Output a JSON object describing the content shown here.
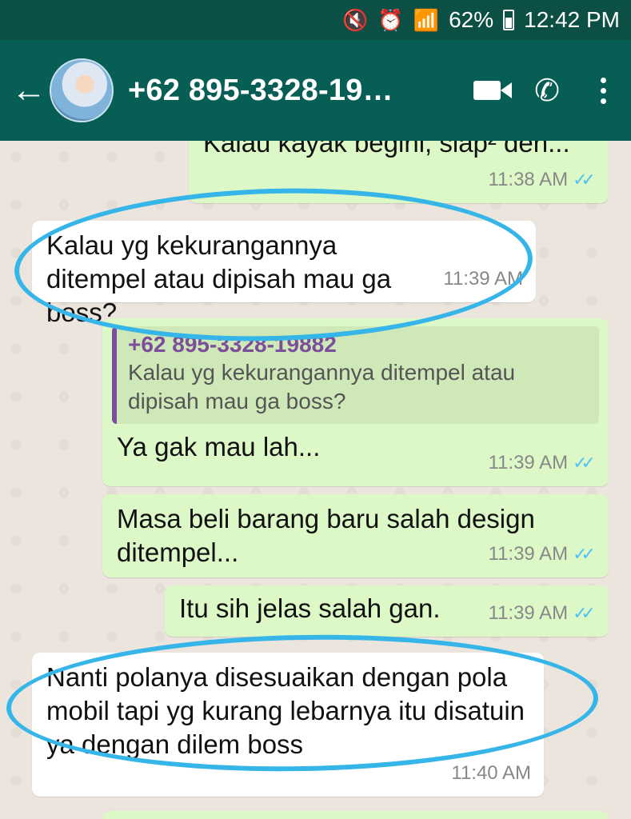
{
  "status_bar": {
    "battery": "62%",
    "time": "12:42 PM"
  },
  "app_bar": {
    "contact_name": "+62 895-3328-19…"
  },
  "messages": [
    {
      "direction": "out",
      "text": "Kalau kayak begini, siap² den...",
      "time": "11:38 AM",
      "ticks": "✓✓"
    },
    {
      "direction": "in",
      "text": "Kalau yg kekurangannya ditempel atau dipisah mau ga boss?",
      "time": "11:39 AM"
    },
    {
      "direction": "out",
      "quote_name": "+62 895-3328-19882",
      "quote_text": "Kalau yg kekurangannya ditempel atau dipisah mau ga boss?",
      "text": "Ya gak mau lah...",
      "time": "11:39 AM",
      "ticks": "✓✓"
    },
    {
      "direction": "out",
      "text": "Masa beli barang baru salah design ditempel...",
      "time": "11:39 AM",
      "ticks": "✓✓"
    },
    {
      "direction": "out",
      "text": "Itu sih jelas salah gan.",
      "time": "11:39 AM",
      "ticks": "✓✓"
    },
    {
      "direction": "in",
      "text": "Nanti polanya disesuaikan dengan pola mobil tapi yg kurang lebarnya itu disatuin ya dengan dilem boss",
      "time": "11:40 AM"
    }
  ],
  "colors": {
    "header": "#075e54",
    "outgoing_bubble": "#dcf8c6",
    "incoming_bubble": "#ffffff",
    "highlight": "#35b5e8"
  }
}
